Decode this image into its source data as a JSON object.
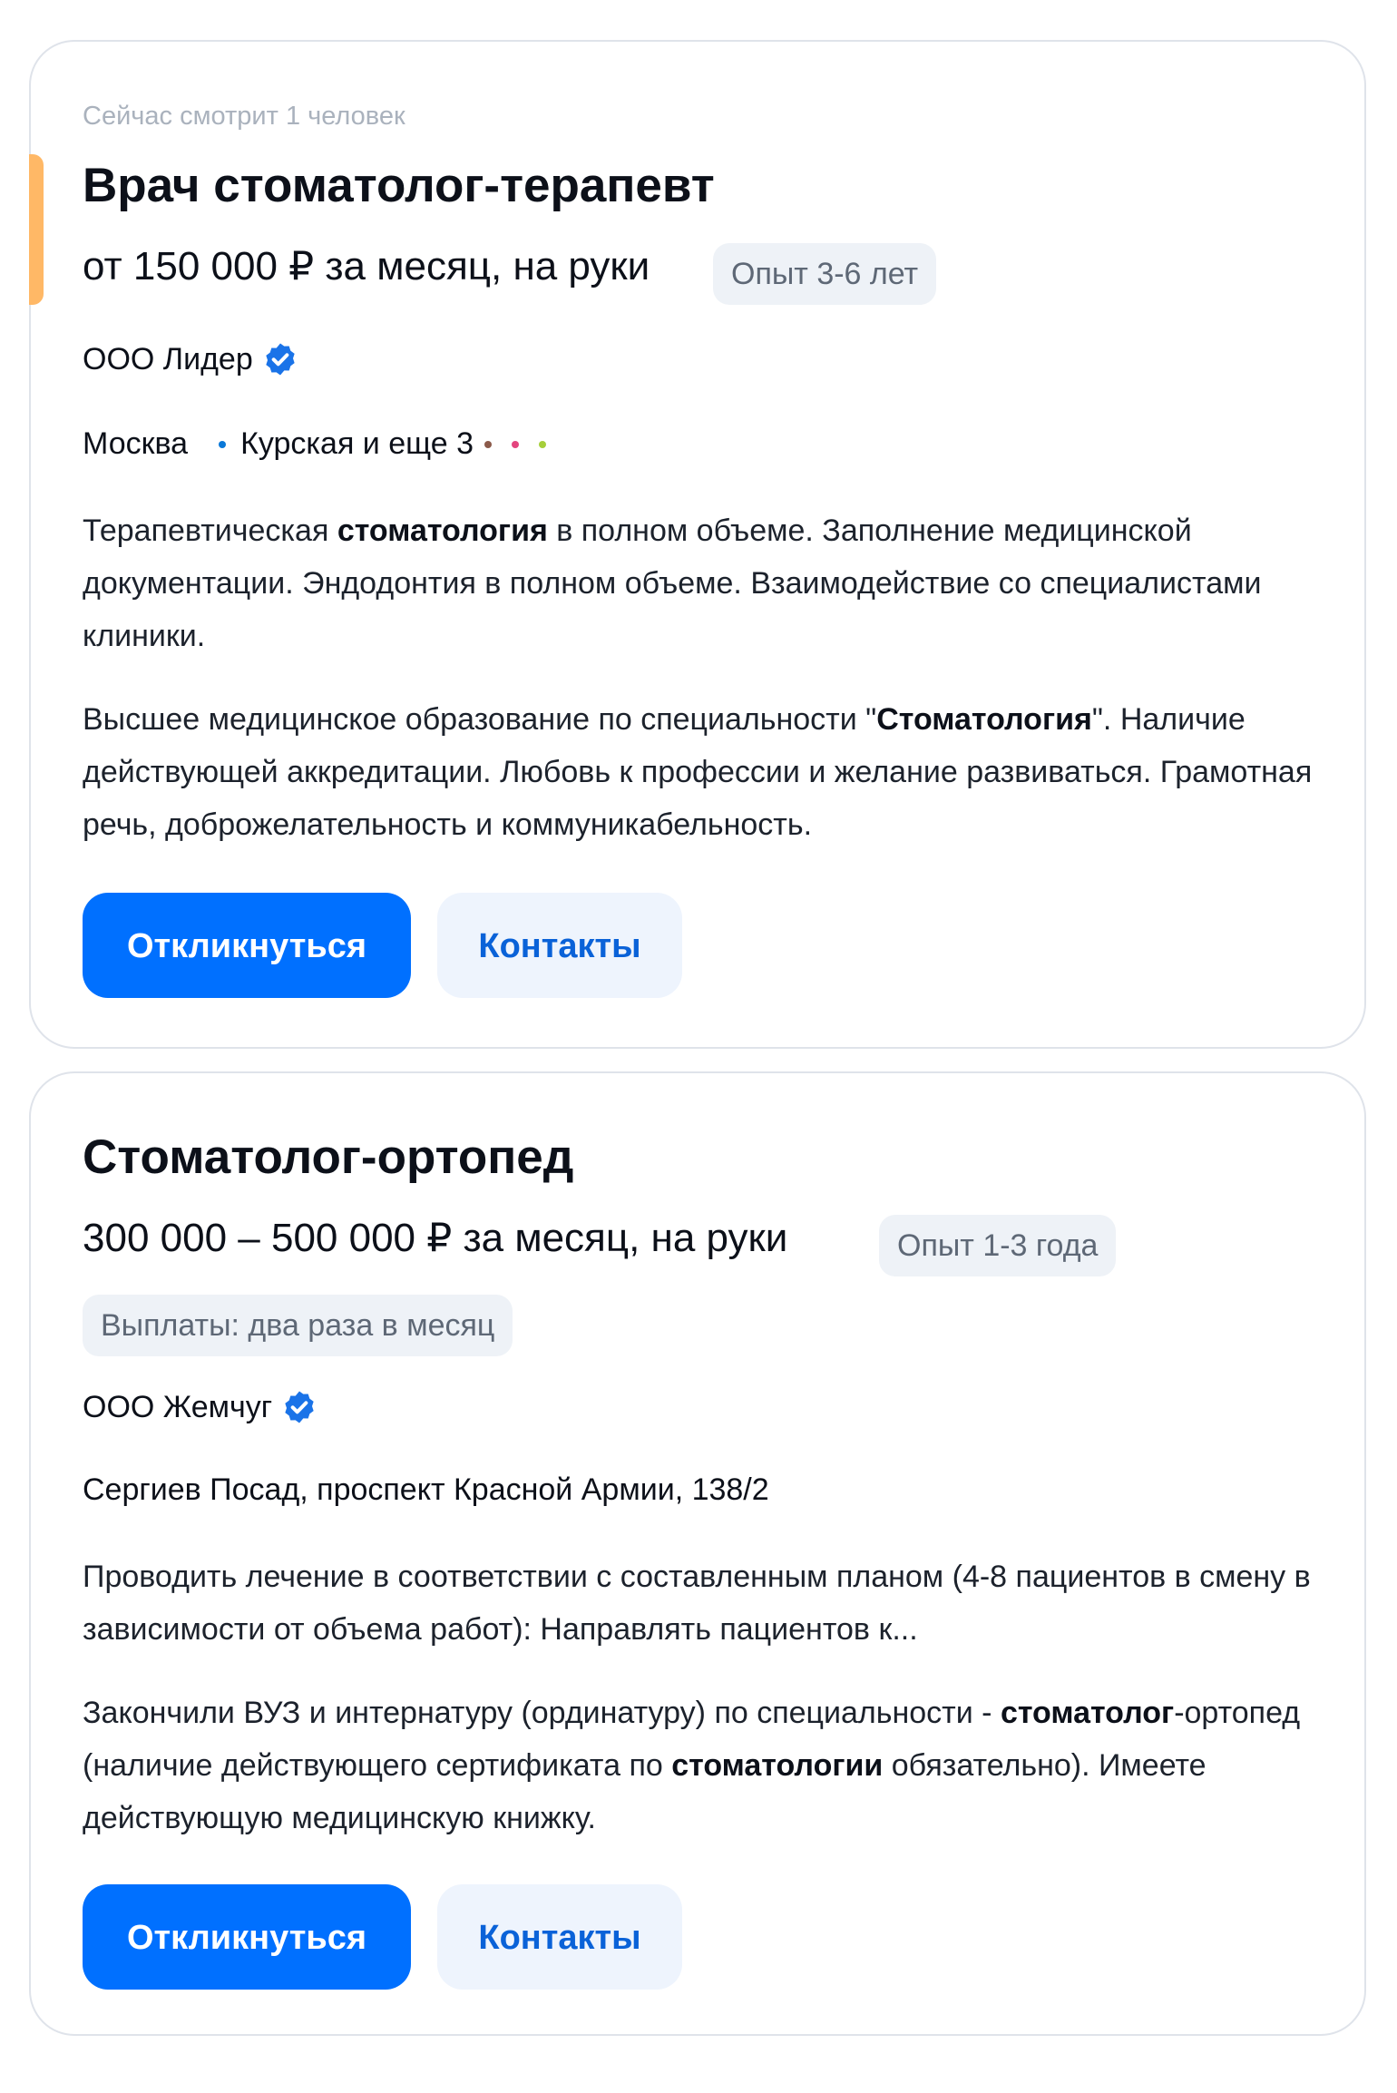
{
  "vacancies": [
    {
      "viewers": "Сейчас смотрит 1 человек",
      "title": "Врач стоматолог-терапевт",
      "salary": "от 150 000 ₽ за месяц, на руки",
      "experience": "Опыт 3-6 лет",
      "company": "ООО Лидер",
      "city": "Москва",
      "metro": "Курская и еще 3",
      "metro_colors": [
        "#0a78d8",
        "#8b5a4a",
        "#e3457e",
        "#a6cf3a"
      ],
      "desc_parts": [
        "Терапевтическая ",
        "стоматология",
        " в полном объеме. Заполнение медицинской документации. Эндодонтия в полном объеме. Взаимодействие со специалистами клиники."
      ],
      "req_parts": [
        "Высшее медицинское образование по специальности \"",
        "Стоматология",
        "\". Наличие действующей аккредитации. Любовь к профессии и желание развиваться. Грамотная речь, доброжелательность и коммуникабельность."
      ],
      "apply_label": "Откликнуться",
      "contacts_label": "Контакты"
    },
    {
      "title": "Стоматолог-ортопед",
      "salary": "300 000 – 500 000 ₽ за месяц, на руки",
      "experience": "Опыт 1-3 года",
      "payments": "Выплаты: два раза в месяц",
      "company": "ООО Жемчуг",
      "address": "Сергиев Посад, проспект Красной Армии, 138/2",
      "desc": "Проводить лечение в соответствии с составленным планом (4-8 пациентов в смену в зависимости от объема работ): Направлять пациентов к...",
      "req_parts": [
        "Закончили ВУЗ и интернатуру (ординатуру) по специальности - ",
        "стоматолог",
        "-ортопед (наличие действующего сертификата по ",
        "стоматологии",
        " обязательно). Имеете действующую медицинскую книжку."
      ],
      "apply_label": "Откликнуться",
      "contacts_label": "Контакты"
    }
  ],
  "colors": {
    "accent_bar": "#ffb866",
    "primary_button": "#0070ff",
    "secondary_button_bg": "#eef4fd",
    "secondary_button_text": "#0a62d8",
    "verified_badge": "#1a73e8"
  },
  "icons": {
    "verified": "verified-check-badge-icon"
  }
}
